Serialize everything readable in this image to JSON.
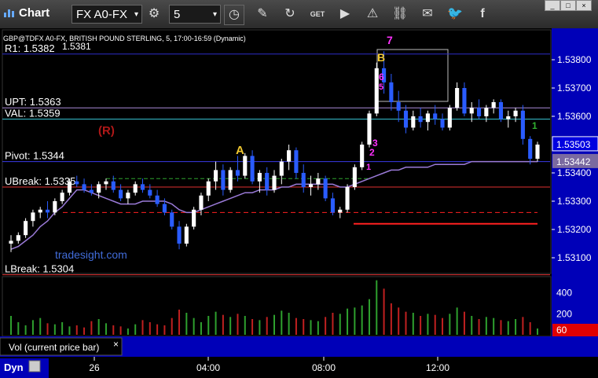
{
  "toolbar": {
    "title": "Chart",
    "symbol": "FX A0-FX",
    "interval": "5",
    "icons": [
      "gear-icon",
      "clock-icon",
      "pencil-icon",
      "refresh-icon",
      "get-icon",
      "play-icon",
      "alert-icon",
      "link-icon",
      "message-icon",
      "twitter-icon",
      "facebook-icon"
    ]
  },
  "chart_header": "GBP@TDFX A0-FX, BRITISH POUND STERLING, 5, 17:00-16:59 (Dynamic)",
  "chart_data": {
    "type": "candlestick",
    "title": "GBP@TDFX A0-FX, BRITISH POUND STERLING, 5, 17:00-16:59 (Dynamic)",
    "price_axis": {
      "min": 1.5305,
      "max": 1.539,
      "ticks": [
        "1.53800",
        "1.53700",
        "1.53600",
        "1.53400",
        "1.53300",
        "1.53200",
        "1.53100"
      ]
    },
    "time_labels": [
      "26",
      "04:00",
      "08:00",
      "12:00"
    ],
    "last_price": "1.53503",
    "ma_price": "1.53442",
    "levels": [
      {
        "label": "R1: 1.5382",
        "value": 1.5382,
        "color": "#2d2dc8"
      },
      {
        "label": "UPT: 1.5363",
        "value": 1.5363,
        "color": "#a98ad8"
      },
      {
        "label": "VAL: 1.5359",
        "value": 1.5359,
        "color": "#38c8d8"
      },
      {
        "label": "Pivot: 1.5344",
        "value": 1.5344,
        "color": "#3a3ae8"
      },
      {
        "label": "UBreak: 1.5335",
        "value": 1.5335,
        "color": "#e03030"
      },
      {
        "label": "LBreak: 1.5304",
        "value": 1.5304,
        "color": "#e03030"
      }
    ],
    "extra_level_label": "1.5381",
    "annotations": [
      {
        "text": "(R)",
        "color": "#b01818"
      },
      {
        "text": "A",
        "color": "#f0c830"
      },
      {
        "text": "B",
        "color": "#f0c830"
      },
      {
        "text": "7",
        "color": "#ff30ff"
      },
      {
        "text": "6",
        "color": "#ff30ff"
      },
      {
        "text": "5",
        "color": "#ff30ff"
      },
      {
        "text": "3",
        "color": "#ff30ff"
      },
      {
        "text": "2",
        "color": "#ff30ff"
      },
      {
        "text": "1",
        "color": "#ff30ff"
      },
      {
        "text": "1",
        "color": "#30b030"
      }
    ],
    "candles": [
      [
        1.5315,
        1.5318,
        1.5312,
        1.5316
      ],
      [
        1.5316,
        1.5319,
        1.5315,
        1.5318
      ],
      [
        1.5318,
        1.5324,
        1.5317,
        1.5323
      ],
      [
        1.5323,
        1.5327,
        1.5321,
        1.5326
      ],
      [
        1.5326,
        1.5328,
        1.5324,
        1.5327
      ],
      [
        1.5327,
        1.533,
        1.5324,
        1.5326
      ],
      [
        1.5326,
        1.5331,
        1.5325,
        1.533
      ],
      [
        1.533,
        1.5334,
        1.5329,
        1.5333
      ],
      [
        1.5333,
        1.5338,
        1.5332,
        1.5337
      ],
      [
        1.5337,
        1.5339,
        1.5335,
        1.5336
      ],
      [
        1.5336,
        1.5338,
        1.5333,
        1.5334
      ],
      [
        1.5334,
        1.5336,
        1.5332,
        1.5333
      ],
      [
        1.5333,
        1.5337,
        1.5331,
        1.5336
      ],
      [
        1.5336,
        1.5338,
        1.5334,
        1.5337
      ],
      [
        1.5337,
        1.5339,
        1.5333,
        1.5334
      ],
      [
        1.5334,
        1.5336,
        1.533,
        1.5331
      ],
      [
        1.5331,
        1.5334,
        1.5329,
        1.5333
      ],
      [
        1.5333,
        1.5337,
        1.5332,
        1.5336
      ],
      [
        1.5336,
        1.5338,
        1.5333,
        1.5334
      ],
      [
        1.5334,
        1.5336,
        1.5331,
        1.5332
      ],
      [
        1.5332,
        1.5334,
        1.5328,
        1.5329
      ],
      [
        1.5329,
        1.5331,
        1.5325,
        1.5326
      ],
      [
        1.5326,
        1.5327,
        1.532,
        1.5321
      ],
      [
        1.5321,
        1.5323,
        1.5313,
        1.5315
      ],
      [
        1.5315,
        1.5322,
        1.5314,
        1.5321
      ],
      [
        1.5321,
        1.5328,
        1.532,
        1.5327
      ],
      [
        1.5327,
        1.5333,
        1.5325,
        1.5332
      ],
      [
        1.5332,
        1.5338,
        1.533,
        1.5337
      ],
      [
        1.5337,
        1.5344,
        1.5334,
        1.5341
      ],
      [
        1.5341,
        1.5343,
        1.5332,
        1.5334
      ],
      [
        1.5334,
        1.5342,
        1.5333,
        1.5341
      ],
      [
        1.5341,
        1.5346,
        1.5337,
        1.5339
      ],
      [
        1.5339,
        1.5347,
        1.5338,
        1.5346
      ],
      [
        1.5346,
        1.5348,
        1.5336,
        1.5337
      ],
      [
        1.5337,
        1.5341,
        1.5333,
        1.534
      ],
      [
        1.534,
        1.5342,
        1.5332,
        1.5334
      ],
      [
        1.5334,
        1.5341,
        1.5333,
        1.5339
      ],
      [
        1.5339,
        1.5345,
        1.5336,
        1.5344
      ],
      [
        1.5344,
        1.535,
        1.5341,
        1.5348
      ],
      [
        1.5348,
        1.5349,
        1.5338,
        1.534
      ],
      [
        1.534,
        1.5343,
        1.5333,
        1.5335
      ],
      [
        1.5335,
        1.5339,
        1.5332,
        1.5336
      ],
      [
        1.5336,
        1.534,
        1.5334,
        1.5338
      ],
      [
        1.5338,
        1.5339,
        1.533,
        1.5331
      ],
      [
        1.5331,
        1.5333,
        1.5325,
        1.5326
      ],
      [
        1.5326,
        1.5328,
        1.5324,
        1.5327
      ],
      [
        1.5327,
        1.5336,
        1.5326,
        1.5335
      ],
      [
        1.5335,
        1.5343,
        1.5334,
        1.5342
      ],
      [
        1.5342,
        1.5351,
        1.5341,
        1.535
      ],
      [
        1.535,
        1.5362,
        1.5349,
        1.5361
      ],
      [
        1.5361,
        1.5379,
        1.536,
        1.5377
      ],
      [
        1.5377,
        1.5383,
        1.5368,
        1.5372
      ],
      [
        1.5372,
        1.5375,
        1.5362,
        1.5365
      ],
      [
        1.5365,
        1.5369,
        1.5358,
        1.5362
      ],
      [
        1.5362,
        1.5364,
        1.5354,
        1.5356
      ],
      [
        1.5356,
        1.5362,
        1.5355,
        1.536
      ],
      [
        1.536,
        1.5363,
        1.5356,
        1.5358
      ],
      [
        1.5358,
        1.5362,
        1.5355,
        1.5361
      ],
      [
        1.5361,
        1.5364,
        1.5357,
        1.5359
      ],
      [
        1.5359,
        1.5361,
        1.5355,
        1.5356
      ],
      [
        1.5356,
        1.5364,
        1.5355,
        1.5363
      ],
      [
        1.5363,
        1.5372,
        1.5362,
        1.537
      ],
      [
        1.537,
        1.5372,
        1.536,
        1.5361
      ],
      [
        1.5361,
        1.5365,
        1.5358,
        1.5363
      ],
      [
        1.5363,
        1.5366,
        1.5359,
        1.536
      ],
      [
        1.536,
        1.5364,
        1.5358,
        1.5363
      ],
      [
        1.5363,
        1.5366,
        1.5361,
        1.5365
      ],
      [
        1.5365,
        1.5366,
        1.5358,
        1.5359
      ],
      [
        1.5359,
        1.5362,
        1.5356,
        1.536
      ],
      [
        1.536,
        1.5363,
        1.5358,
        1.5362
      ],
      [
        1.5362,
        1.5364,
        1.535,
        1.5352
      ],
      [
        1.5352,
        1.5353,
        1.5343,
        1.5345
      ],
      [
        1.5345,
        1.5351,
        1.5344,
        1.535
      ]
    ],
    "ma_line": [
      1.5313,
      1.5314,
      1.5316,
      1.5318,
      1.5321,
      1.5323,
      1.5326,
      1.5328,
      1.5331,
      1.5334,
      1.5334,
      1.5333,
      1.5332,
      1.5331,
      1.533,
      1.5329,
      1.5329,
      1.5329,
      1.533,
      1.533,
      1.533,
      1.533,
      1.5329,
      1.5327,
      1.5326,
      1.5326,
      1.5327,
      1.5328,
      1.5329,
      1.533,
      1.5331,
      1.5332,
      1.5333,
      1.5333,
      1.5334,
      1.5334,
      1.5334,
      1.5335,
      1.5335,
      1.5336,
      1.5336,
      1.5336,
      1.5336,
      1.5336,
      1.5336,
      1.5335,
      1.5335,
      1.5336,
      1.5337,
      1.5338,
      1.5339,
      1.534,
      1.5341,
      1.5341,
      1.5342,
      1.5342,
      1.5342,
      1.5342,
      1.5343,
      1.5343,
      1.5343,
      1.5343,
      1.5343,
      1.5344,
      1.5344,
      1.5344,
      1.5344,
      1.5344,
      1.5344,
      1.5344,
      1.5344,
      1.5344,
      1.5344
    ],
    "volume": {
      "axis_ticks": [
        "400",
        "200"
      ],
      "current_label": "60",
      "max": 540,
      "values": [
        180,
        120,
        90,
        140,
        160,
        110,
        100,
        120,
        80,
        90,
        70,
        130,
        150,
        110,
        90,
        80,
        60,
        100,
        140,
        120,
        100,
        90,
        160,
        240,
        210,
        160,
        120,
        180,
        220,
        190,
        170,
        200,
        180,
        150,
        140,
        170,
        190,
        230,
        210,
        160,
        150,
        140,
        130,
        170,
        210,
        200,
        250,
        260,
        280,
        340,
        520,
        440,
        300,
        260,
        220,
        210,
        180,
        200,
        190,
        160,
        200,
        260,
        220,
        180,
        150,
        170,
        160,
        140,
        130,
        150,
        170,
        120,
        60
      ]
    }
  },
  "panels": {
    "volume_label": "Vol (current price bar)",
    "close_label": "×"
  },
  "bottom": {
    "mode": "Dyn"
  },
  "watermark": "tradesight.com"
}
